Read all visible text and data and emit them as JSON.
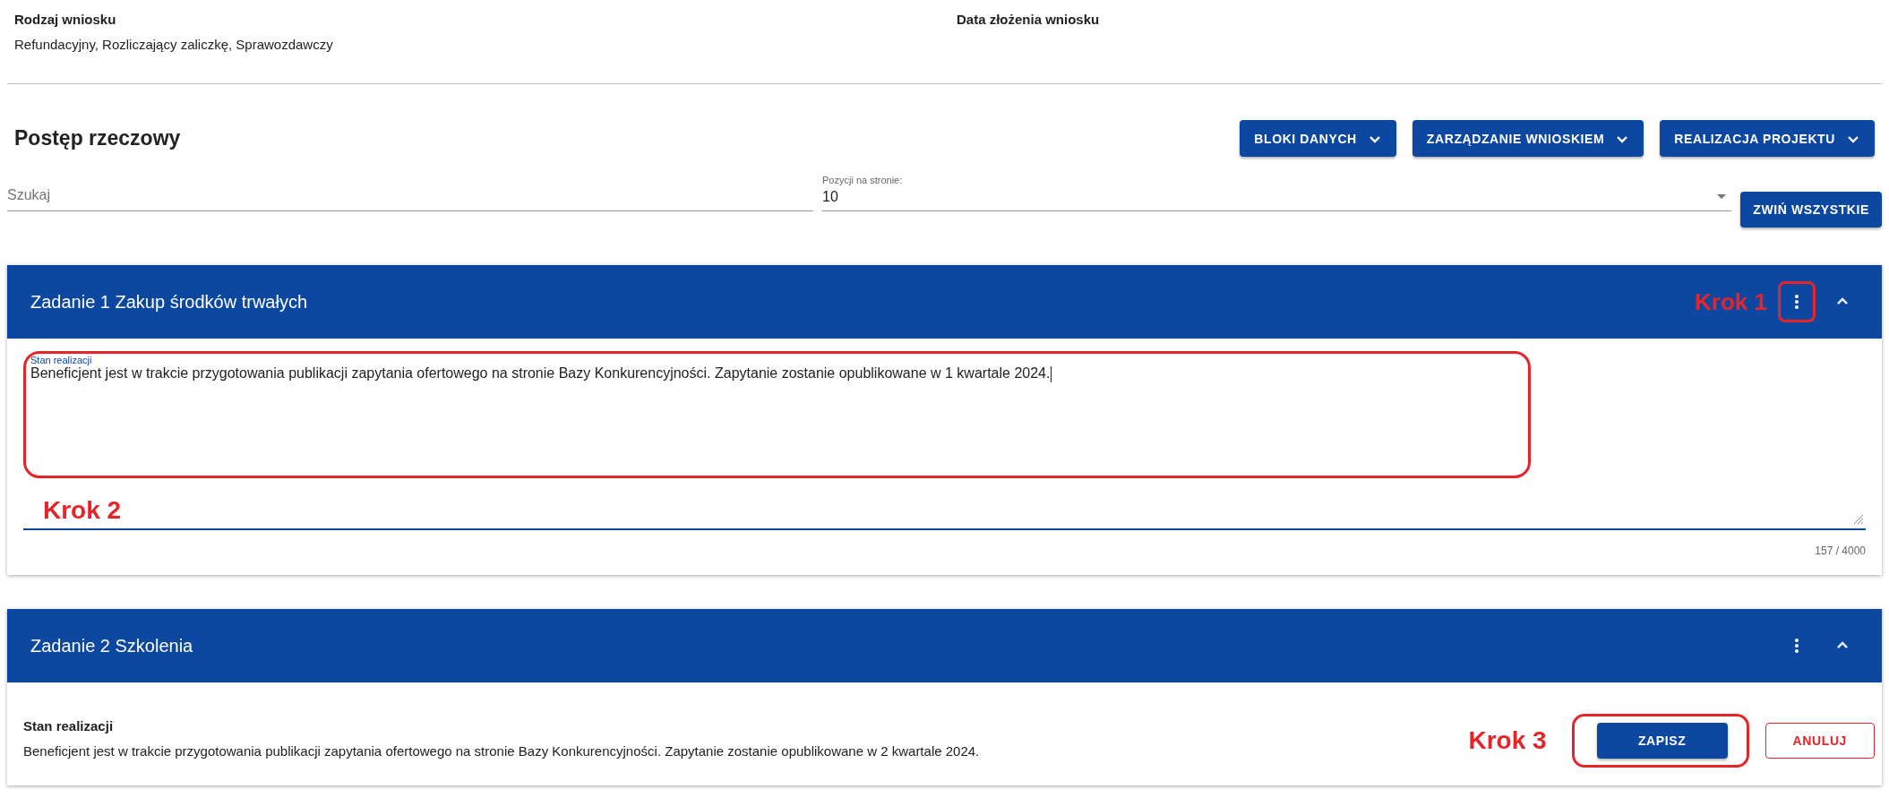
{
  "summary": {
    "fields": [
      {
        "label": "Rodzaj wniosku",
        "value": "Refundacyjny, Rozliczający zaliczkę, Sprawozdawczy"
      },
      {
        "label": "Data złożenia wniosku"
      }
    ]
  },
  "section": {
    "title": "Postęp rzeczowy",
    "menus": [
      {
        "label": "BLOKI DANYCH"
      },
      {
        "label": "ZARZĄDZANIE WNIOSKIEM"
      },
      {
        "label": "REALIZACJA PROJEKTU"
      }
    ]
  },
  "filters": {
    "search": {
      "placeholder": "Szukaj"
    },
    "page_size": {
      "label": "Pozycji na stronie:",
      "value": "10"
    },
    "collapse_button": "ZWIŃ WSZYSTKIE"
  },
  "tasks": [
    {
      "title": "Zadanie 1 Zakup środków trwałych",
      "expanded": true,
      "kind": "editing",
      "field_label": "Stan realizacji",
      "value": "Beneficjent jest w trakcie przygotowania publikacji zapytania ofertowego na stronie Bazy Konkurencyjności. Zapytanie zostanie opublikowane w 1 kwartale 2024.",
      "counter": "157 / 4000",
      "menu_annotation": "Krok 1",
      "field_annotation": "Krok 2"
    },
    {
      "title": "Zadanie 2 Szkolenia",
      "expanded": true,
      "kind": "view",
      "field_label": "Stan realizacji",
      "value": "Beneficjent jest w trakcie przygotowania publikacji zapytania ofertowego na stronie Bazy Konkurencyjności. Zapytanie zostanie opublikowane w 2 kwartale 2024.",
      "actions": [
        {
          "label": "ZAPISZ",
          "kind": "primary"
        },
        {
          "label": "ANULUJ",
          "kind": "outlined"
        }
      ],
      "actions_annotation": "Krok 3"
    }
  ]
}
